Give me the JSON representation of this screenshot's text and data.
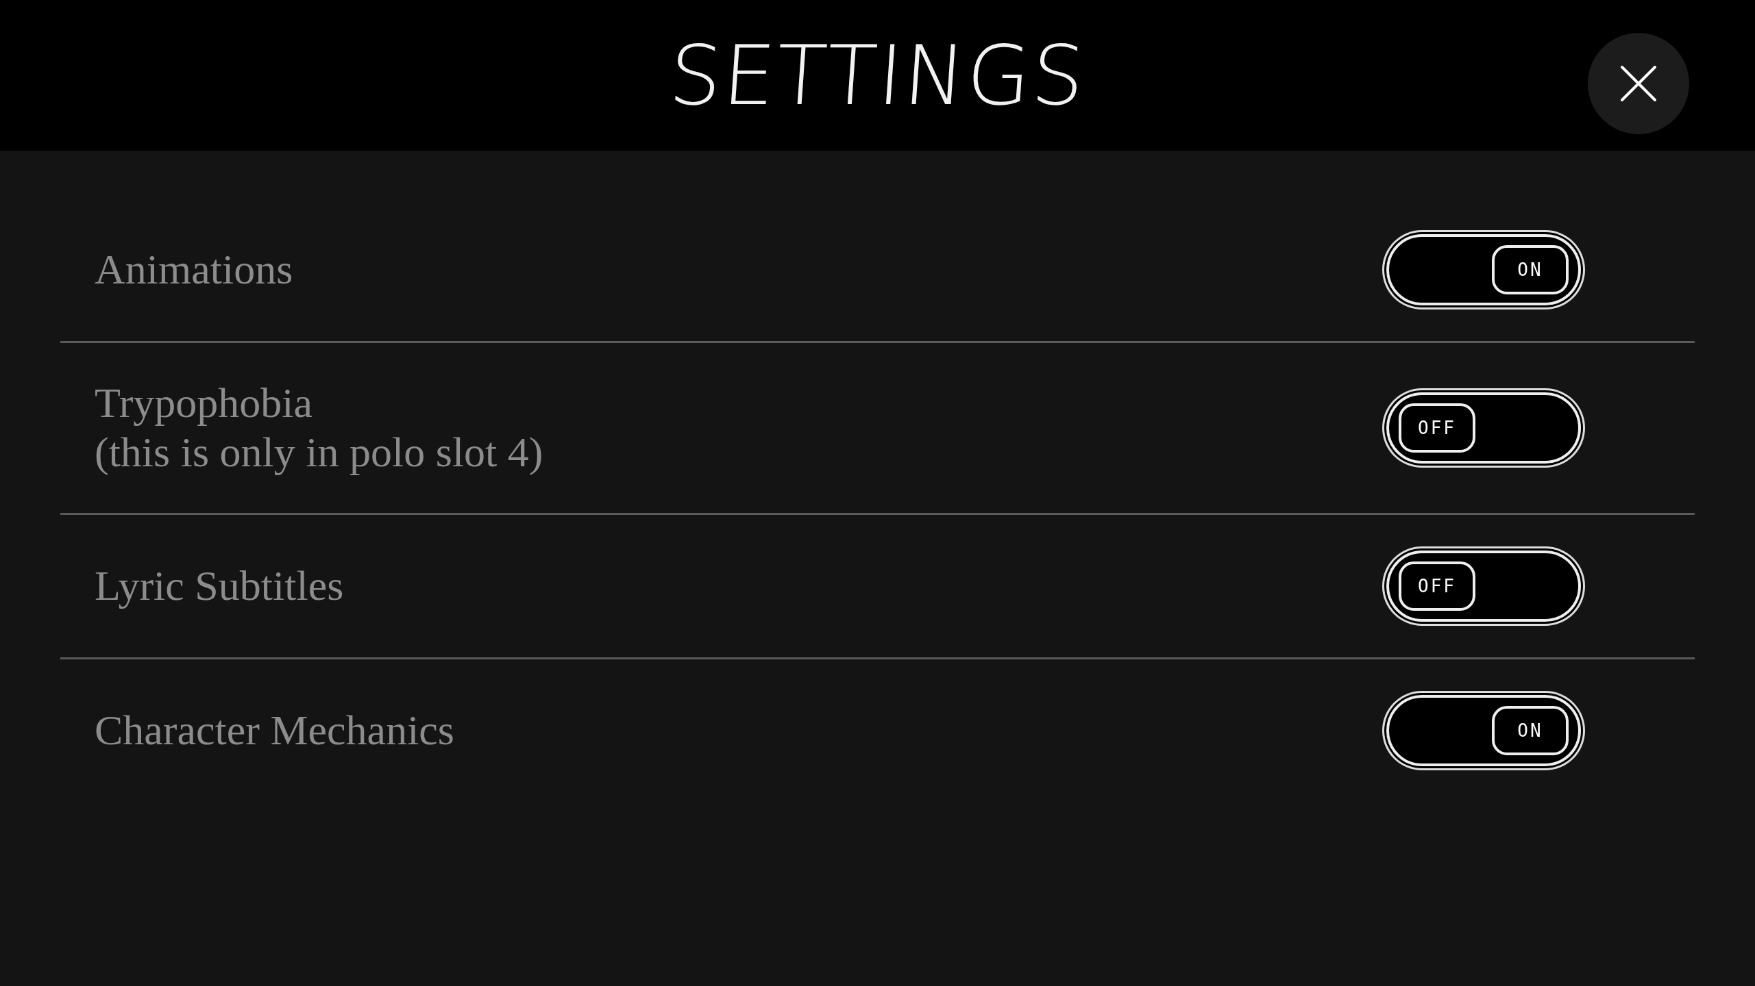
{
  "header": {
    "title": "SETTINGS"
  },
  "settings": [
    {
      "label": "Animations",
      "on": true,
      "state_label": "ON"
    },
    {
      "label": "Trypophobia\n(this is only in polo slot 4)",
      "on": false,
      "state_label": "OFF"
    },
    {
      "label": "Lyric Subtitles",
      "on": false,
      "state_label": "OFF"
    },
    {
      "label": "Character Mechanics",
      "on": true,
      "state_label": "ON"
    }
  ]
}
